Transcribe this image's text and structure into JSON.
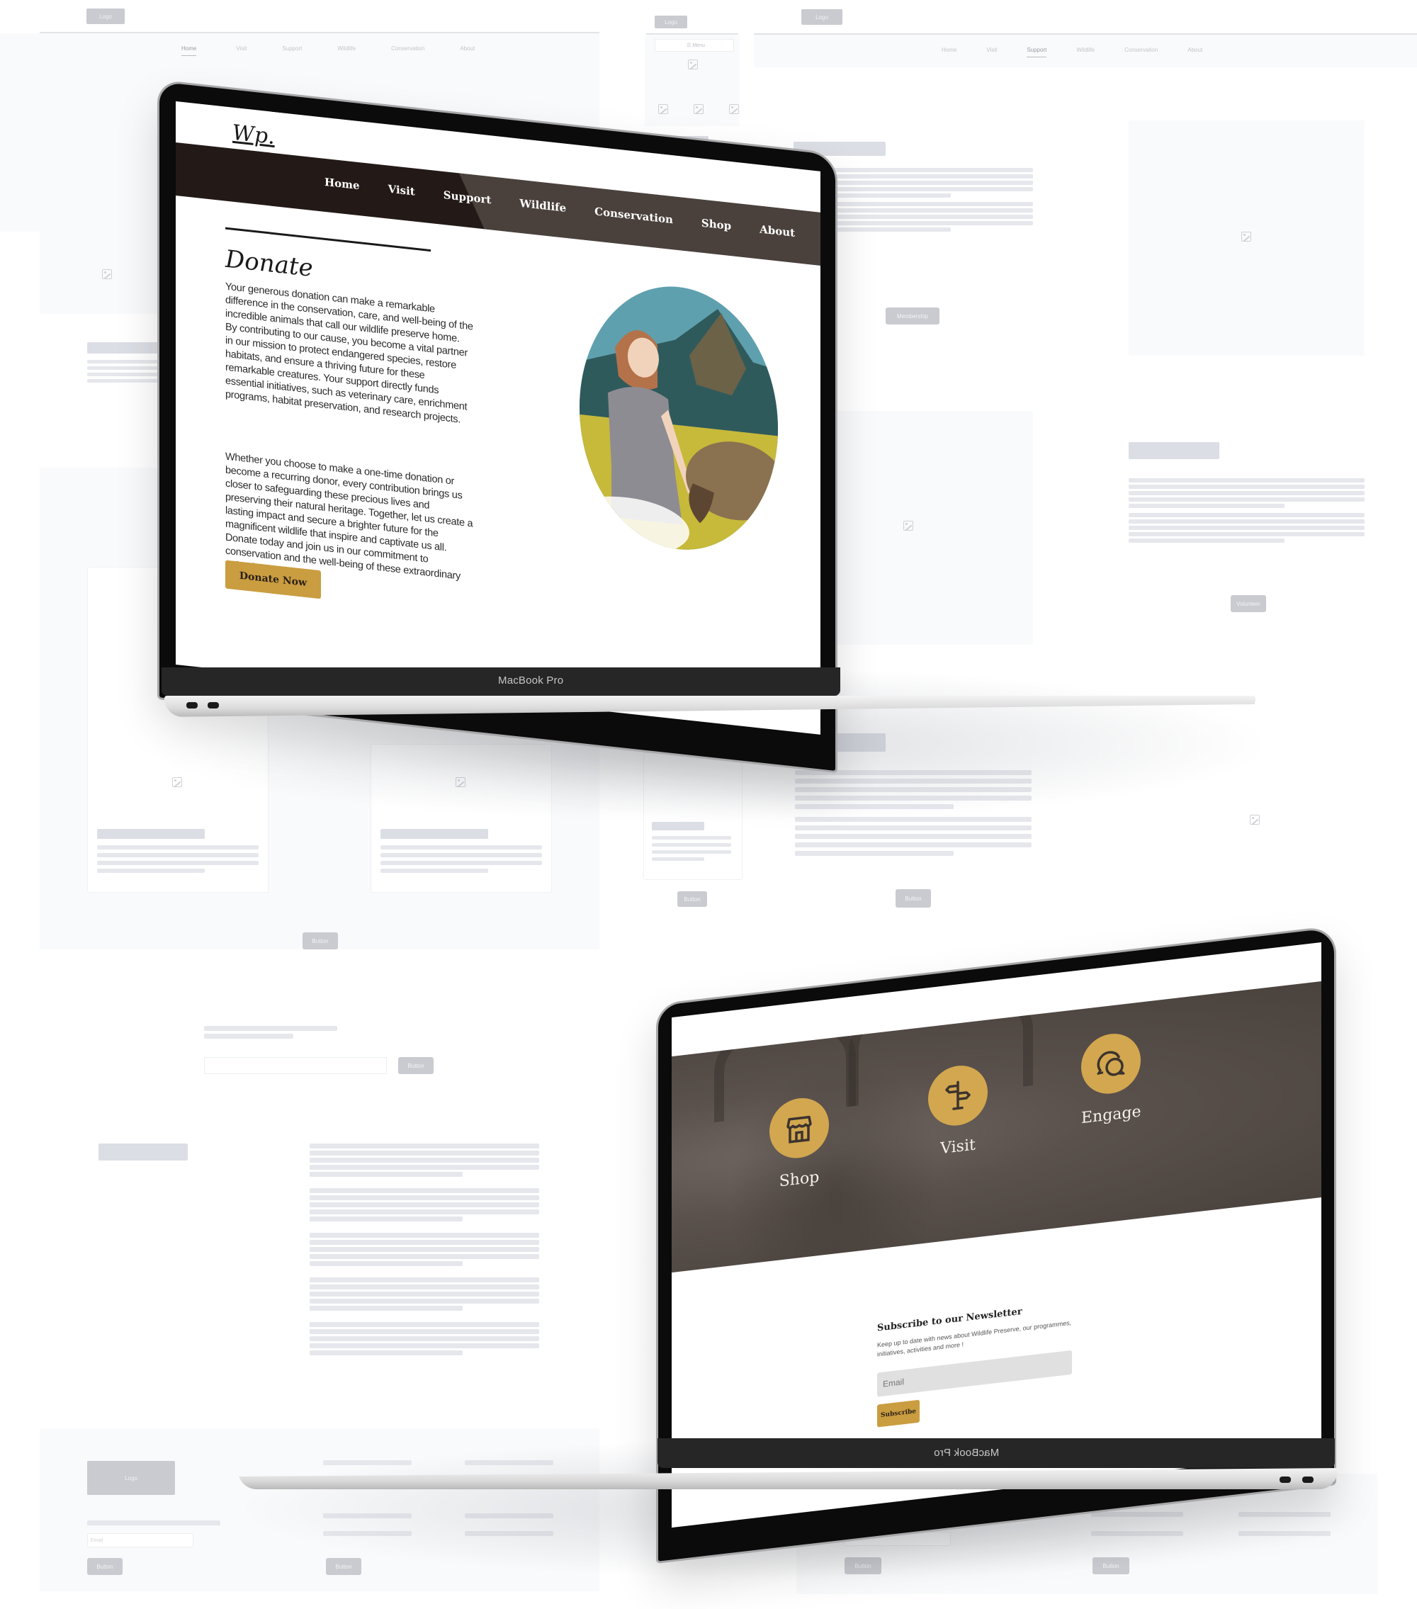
{
  "wireframes": {
    "home_nav": {
      "logo": "Logo",
      "items": [
        "Home",
        "Visit",
        "Support",
        "Wildlife",
        "Conservation",
        "About"
      ],
      "active": "Home"
    },
    "mobile": {
      "logo": "Logo",
      "menu_button": "☰ Menu"
    },
    "support_nav": {
      "logo": "Logo",
      "items": [
        "Home",
        "Visit",
        "Support",
        "Wildlife",
        "Conservation",
        "About"
      ],
      "active": "Support"
    },
    "buttons": {
      "membership": "Membership",
      "volunteer": "Volunteer",
      "generic": "Button"
    },
    "footer": {
      "logo": "Logo",
      "email_placeholder": "Email",
      "button": "Button"
    }
  },
  "laptop1": {
    "device_label": "MacBook Pro",
    "logo": "Wp.",
    "nav": [
      "Home",
      "Visit",
      "Support",
      "Wildlife",
      "Conservation",
      "Shop",
      "About"
    ],
    "title": "Donate",
    "paragraph1": "Your generous donation can make a remarkable difference in the conservation, care, and well-being of the incredible animals that call our wildlife preserve home. By contributing to our cause, you become a vital partner in our mission to protect endangered species, restore habitats, and ensure a thriving future for these remarkable creatures. Your support directly funds essential initiatives, such as veterinary care, enrichment programs, habitat preservation, and research projects.",
    "paragraph2": "Whether you choose to make a one-time donation or become a recurring donor, every contribution brings us closer to safeguarding these precious lives and preserving their natural heritage. Together, let us create a lasting impact and secure a brighter future for the magnificent wildlife that inspire and captivate us all. Donate today and join us in our commitment to conservation and the well-being of these extraordinary animals.",
    "donate_button": "Donate Now",
    "illustration": "woman-with-animal-illustration"
  },
  "laptop2": {
    "device_label": "MacBook Pro",
    "features": [
      {
        "label": "Shop",
        "icon": "storefront-icon"
      },
      {
        "label": "Visit",
        "icon": "signpost-icon"
      },
      {
        "label": "Engage",
        "icon": "chat-bubbles-icon"
      }
    ],
    "newsletter": {
      "title": "Subscribe to our Newsletter",
      "subtitle": "Keep up to date with news about Wildlife Preserve, our programmes, initiatives, activities and more !",
      "email_placeholder": "Email",
      "button": "Subscribe"
    }
  },
  "colors": {
    "accent_gold": "#c99d40",
    "nav_dark": "#231a17",
    "nav_mid": "#4a413c",
    "hero_brown": "#5a514c"
  }
}
